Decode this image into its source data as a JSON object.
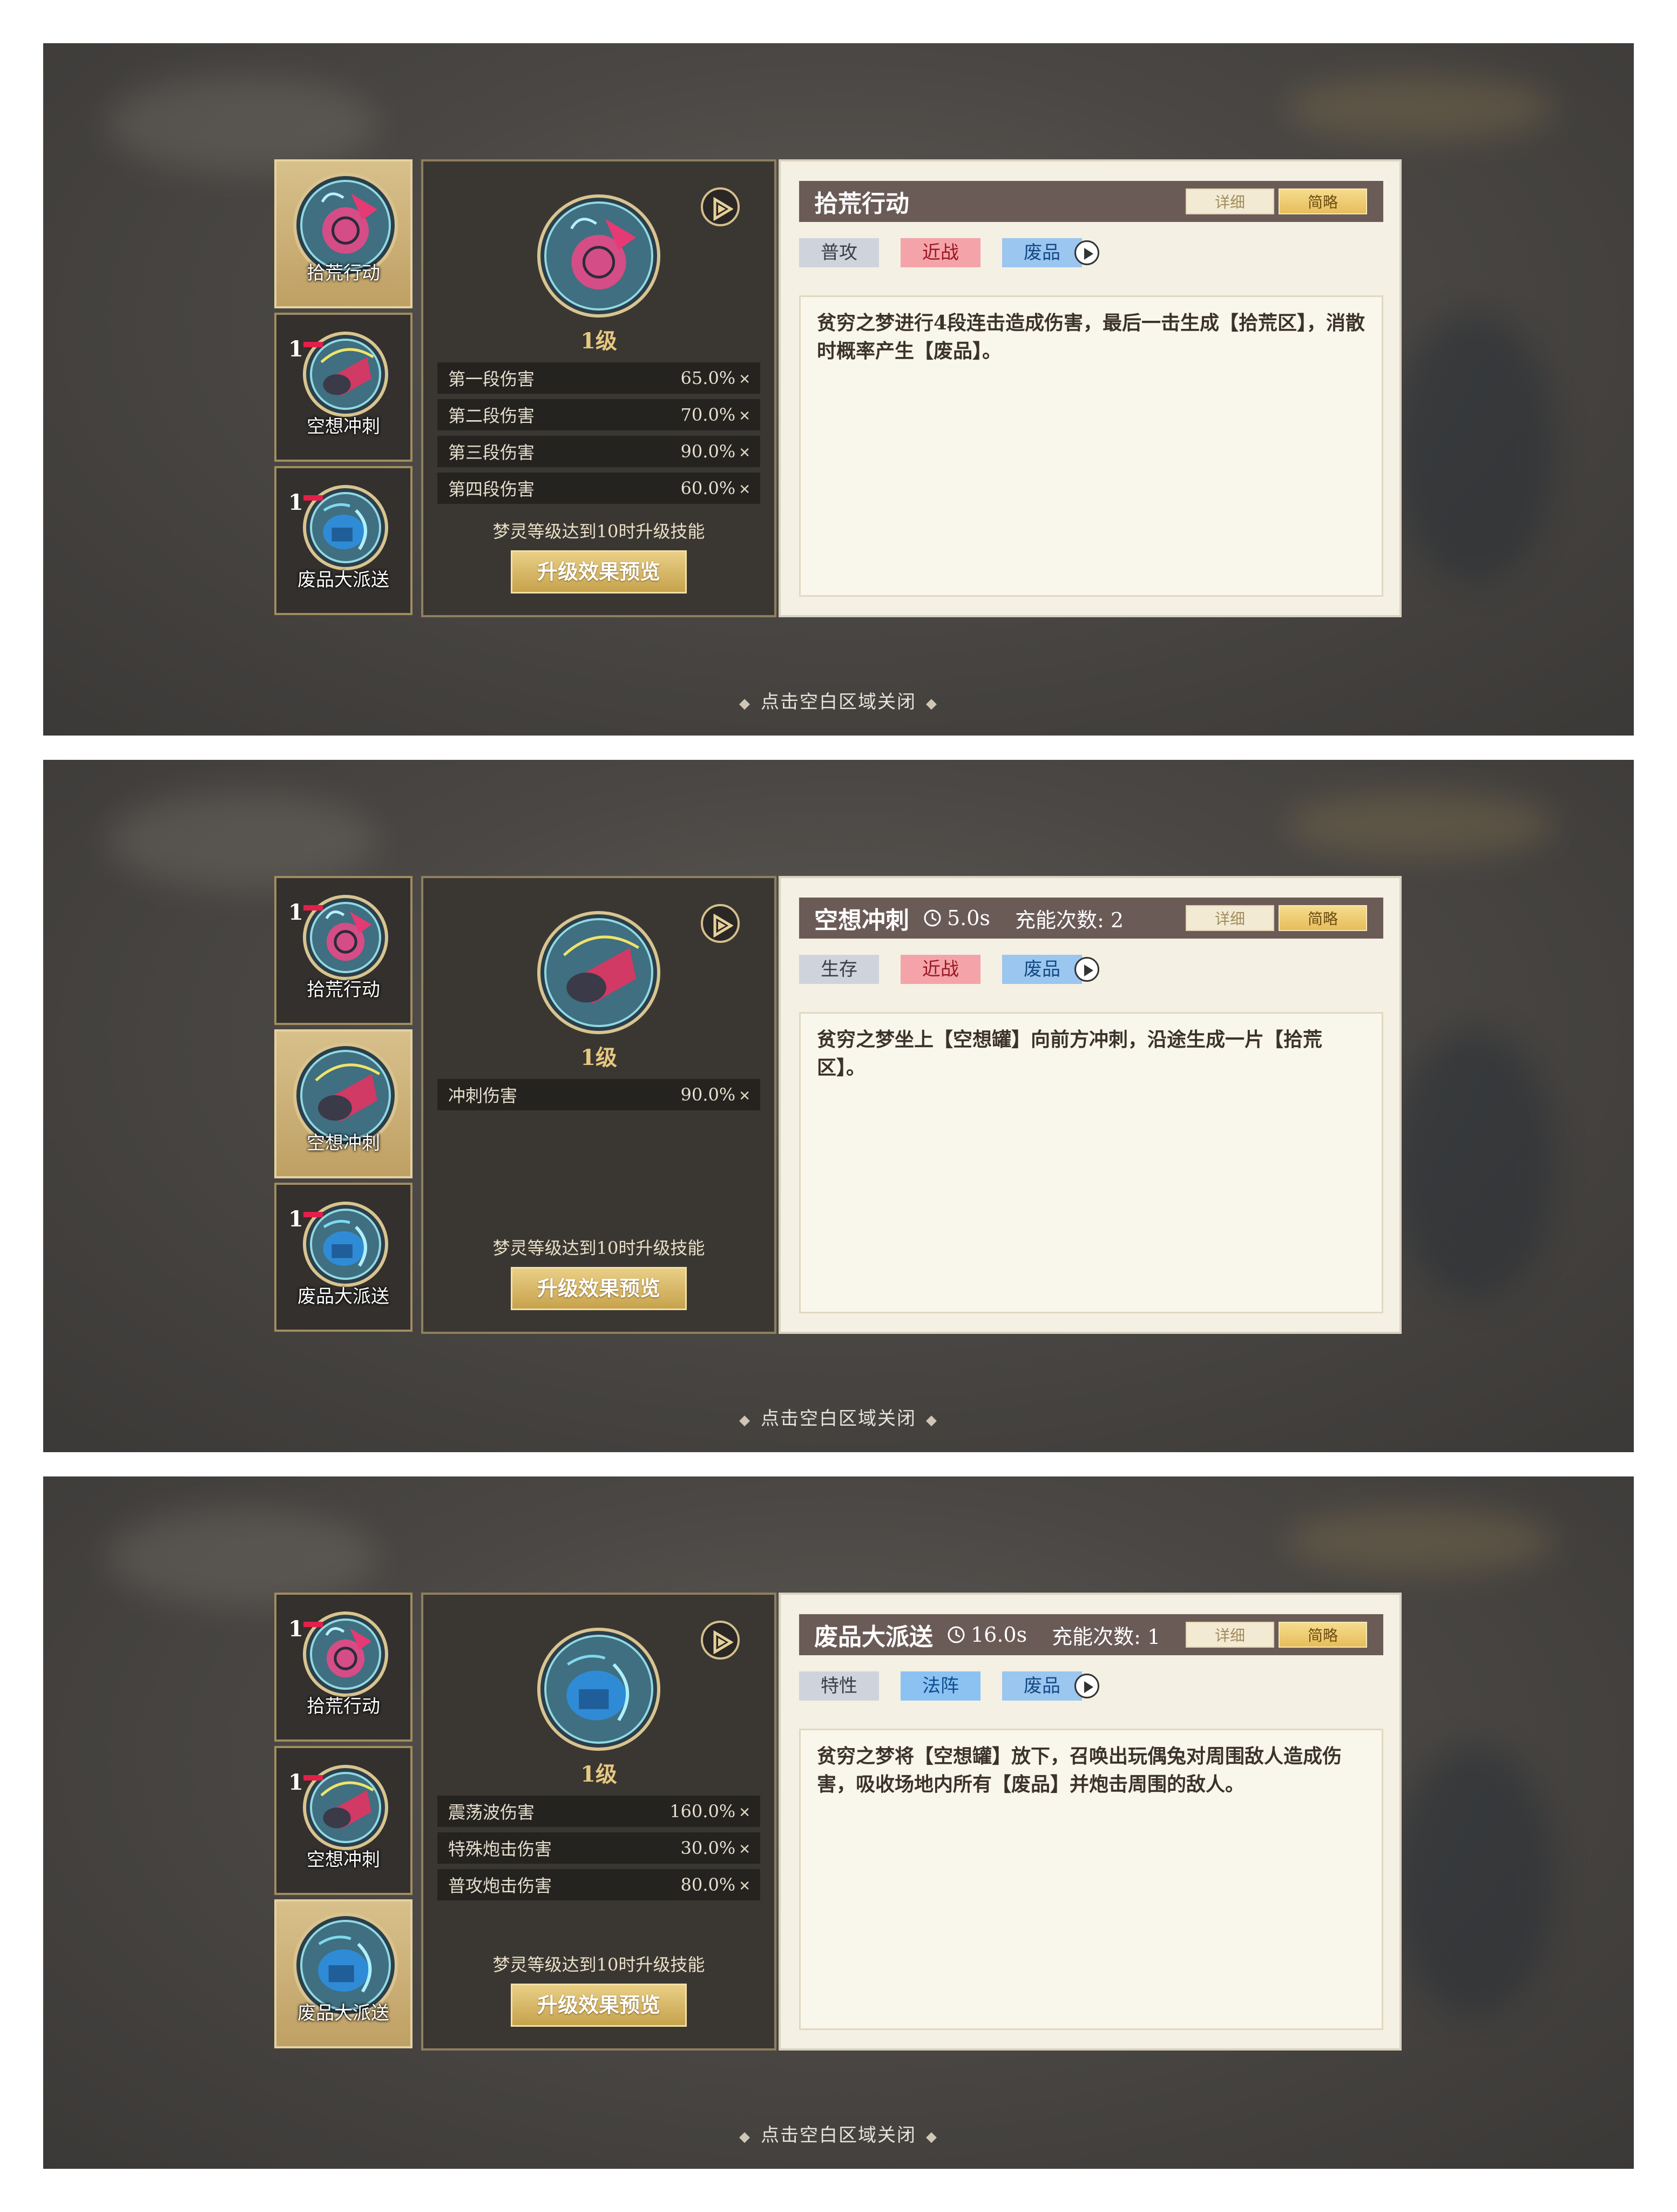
{
  "screens": [
    {
      "tabs": [
        {
          "label": "拾荒行动",
          "level": "",
          "active": true,
          "icon": "scavenge-icon"
        },
        {
          "label": "空想冲刺",
          "level": "1",
          "active": false,
          "icon": "dash-icon"
        },
        {
          "label": "废品大派送",
          "level": "1",
          "active": false,
          "icon": "junk-delivery-icon"
        }
      ],
      "level_label": "1级",
      "stats": [
        {
          "name": "第一段伤害",
          "value": "65.0%"
        },
        {
          "name": "第二段伤害",
          "value": "70.0%"
        },
        {
          "name": "第三段伤害",
          "value": "90.0%"
        },
        {
          "name": "第四段伤害",
          "value": "60.0%"
        }
      ],
      "upgrade_note": "梦灵等级达到10时升级技能",
      "preview_button": "升级效果预览",
      "title": "拾荒行动",
      "cooldown": "",
      "charges": "",
      "mode_detail": "详细",
      "mode_brief": "简略",
      "tags": [
        {
          "text": "普攻",
          "style": "type"
        },
        {
          "text": "近战",
          "style": "red"
        },
        {
          "text": "废品",
          "style": "blue"
        }
      ],
      "description": "贫穷之梦进行4段连击造成伤害，最后一击生成【拾荒区】，消散时概率产生【废品】。",
      "close_hint": "点击空白区域关闭"
    },
    {
      "tabs": [
        {
          "label": "拾荒行动",
          "level": "1",
          "active": false,
          "icon": "scavenge-icon"
        },
        {
          "label": "空想冲刺",
          "level": "",
          "active": true,
          "icon": "dash-icon"
        },
        {
          "label": "废品大派送",
          "level": "1",
          "active": false,
          "icon": "junk-delivery-icon"
        }
      ],
      "level_label": "1级",
      "stats": [
        {
          "name": "冲刺伤害",
          "value": "90.0%"
        }
      ],
      "upgrade_note": "梦灵等级达到10时升级技能",
      "preview_button": "升级效果预览",
      "title": "空想冲刺",
      "cooldown": "5.0s",
      "charges": "充能次数: 2",
      "mode_detail": "详细",
      "mode_brief": "简略",
      "tags": [
        {
          "text": "生存",
          "style": "type"
        },
        {
          "text": "近战",
          "style": "red"
        },
        {
          "text": "废品",
          "style": "blue"
        }
      ],
      "description": "贫穷之梦坐上【空想罐】向前方冲刺，沿途生成一片【拾荒区】。",
      "close_hint": "点击空白区域关闭"
    },
    {
      "tabs": [
        {
          "label": "拾荒行动",
          "level": "1",
          "active": false,
          "icon": "scavenge-icon"
        },
        {
          "label": "空想冲刺",
          "level": "1",
          "active": false,
          "icon": "dash-icon"
        },
        {
          "label": "废品大派送",
          "level": "",
          "active": true,
          "icon": "junk-delivery-icon"
        }
      ],
      "level_label": "1级",
      "stats": [
        {
          "name": "震荡波伤害",
          "value": "160.0%"
        },
        {
          "name": "特殊炮击伤害",
          "value": "30.0%"
        },
        {
          "name": "普攻炮击伤害",
          "value": "80.0%"
        }
      ],
      "upgrade_note": "梦灵等级达到10时升级技能",
      "preview_button": "升级效果预览",
      "title": "废品大派送",
      "cooldown": "16.0s",
      "charges": "充能次数: 1",
      "mode_detail": "详细",
      "mode_brief": "简略",
      "tags": [
        {
          "text": "特性",
          "style": "type"
        },
        {
          "text": "法阵",
          "style": "blue-strong"
        },
        {
          "text": "废品",
          "style": "blue"
        }
      ],
      "description": "贫穷之梦将【空想罐】放下，召唤出玩偶兔对周围敌人造成伤害，吸收场地内所有【废品】并炮击周围的敌人。",
      "close_hint": "点击空白区域关闭"
    }
  ],
  "multiplier_symbol": "✕",
  "colors": {
    "title_bar": "#6b5b57",
    "gold": "#e7c880",
    "tag_red": "#f4a4a8",
    "tag_blue": "#9bc6ef",
    "tag_gray": "#cfd4dc"
  }
}
